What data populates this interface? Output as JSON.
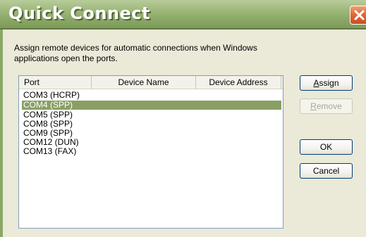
{
  "window": {
    "title": "Quick Connect"
  },
  "description": "Assign remote devices for automatic connections when Windows applications open the ports.",
  "list": {
    "columns": [
      "Port",
      "Device Name",
      "Device Address"
    ],
    "rows": [
      {
        "port": "COM3 (HCRP)",
        "selected": false
      },
      {
        "port": "COM4 (SPP)",
        "selected": true
      },
      {
        "port": "COM5 (SPP)",
        "selected": false
      },
      {
        "port": "COM8 (SPP)",
        "selected": false
      },
      {
        "port": "COM9 (SPP)",
        "selected": false
      },
      {
        "port": "COM12 (DUN)",
        "selected": false
      },
      {
        "port": "COM13 (FAX)",
        "selected": false
      }
    ]
  },
  "buttons": {
    "assign": {
      "mnemonic": "A",
      "rest": "ssign"
    },
    "remove": {
      "mnemonic": "R",
      "rest": "emove",
      "disabled": true
    },
    "ok": "OK",
    "cancel": "Cancel"
  },
  "colors": {
    "titlebar": "#8aa766",
    "selection": "#8a9f66",
    "close": "#e06a3a"
  }
}
